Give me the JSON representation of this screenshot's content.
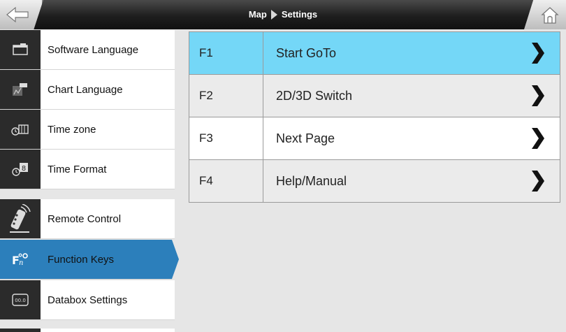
{
  "header": {
    "crumb_root": "Map",
    "crumb_current": "Settings",
    "back_icon": "back-arrow-icon",
    "home_icon": "home-icon"
  },
  "sidebar": {
    "items": [
      {
        "label": "Software Language",
        "icon": "software-language-icon"
      },
      {
        "label": "Chart Language",
        "icon": "chart-language-icon"
      },
      {
        "label": "Time zone",
        "icon": "time-zone-icon"
      },
      {
        "label": "Time Format",
        "icon": "time-format-icon"
      },
      {
        "label": "Remote Control",
        "icon": "remote-control-icon"
      },
      {
        "label": "Function Keys",
        "icon": "function-keys-icon",
        "active": true
      },
      {
        "label": "Databox Settings",
        "icon": "databox-icon"
      }
    ]
  },
  "function_keys": [
    {
      "key": "F1",
      "function": "Start GoTo",
      "highlighted": true
    },
    {
      "key": "F2",
      "function": "2D/3D Switch"
    },
    {
      "key": "F3",
      "function": "Next Page"
    },
    {
      "key": "F4",
      "function": "Help/Manual"
    }
  ],
  "colors": {
    "active_blue": "#2c7fbb",
    "highlight_cyan": "#74d7f7"
  }
}
